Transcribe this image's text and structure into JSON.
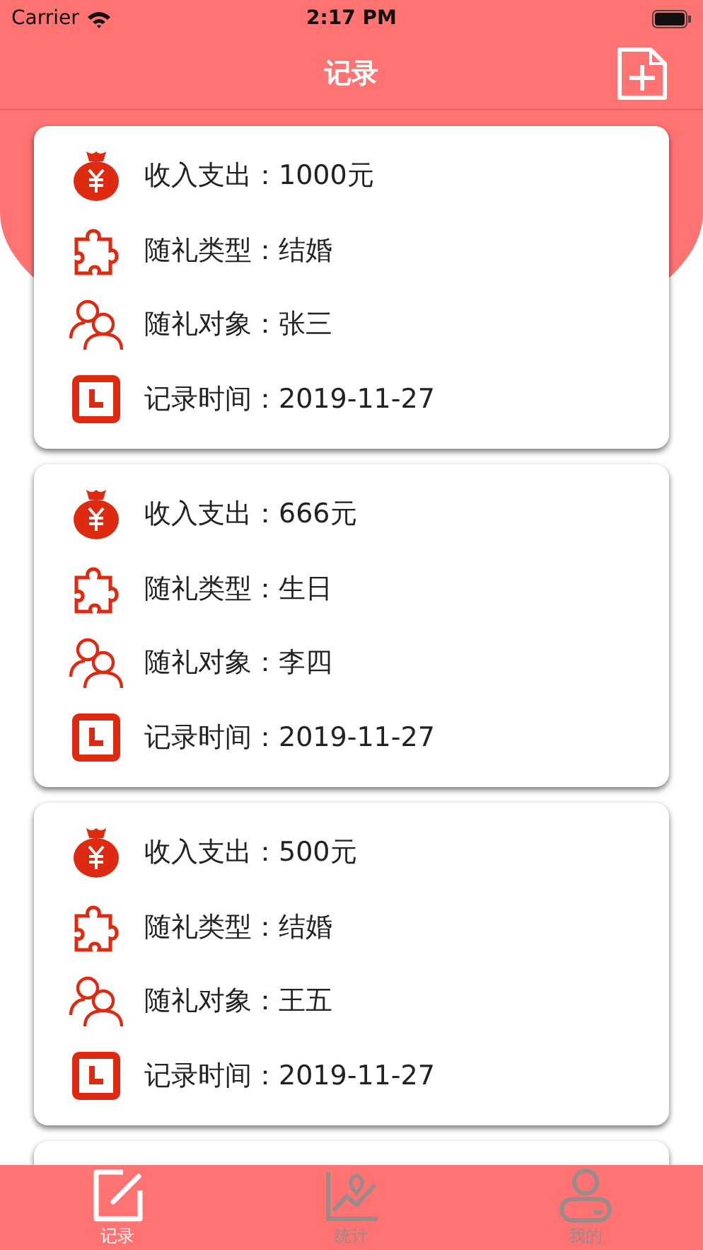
{
  "status_bar": {
    "carrier": "Carrier",
    "time": "2:17 PM"
  },
  "nav": {
    "title": "记录"
  },
  "records": [
    {
      "rows": [
        {
          "kind": "amount",
          "text": "收入支出：1000元"
        },
        {
          "kind": "type",
          "text": "随礼类型：结婚"
        },
        {
          "kind": "person",
          "text": "随礼对象：张三"
        },
        {
          "kind": "time",
          "text": "记录时间：2019-11-27"
        }
      ]
    },
    {
      "rows": [
        {
          "kind": "amount",
          "text": "收入支出：666元"
        },
        {
          "kind": "type",
          "text": "随礼类型：生日"
        },
        {
          "kind": "person",
          "text": "随礼对象：李四"
        },
        {
          "kind": "time",
          "text": "记录时间：2019-11-27"
        }
      ]
    },
    {
      "rows": [
        {
          "kind": "amount",
          "text": "收入支出：500元"
        },
        {
          "kind": "type",
          "text": "随礼类型：结婚"
        },
        {
          "kind": "person",
          "text": "随礼对象：王五"
        },
        {
          "kind": "time",
          "text": "记录时间：2019-11-27"
        }
      ]
    }
  ],
  "tabs": [
    {
      "kind": "edit",
      "label": "记录",
      "selected": true
    },
    {
      "kind": "chart",
      "label": "统计",
      "selected": false
    },
    {
      "kind": "user",
      "label": "我的",
      "selected": false
    }
  ]
}
